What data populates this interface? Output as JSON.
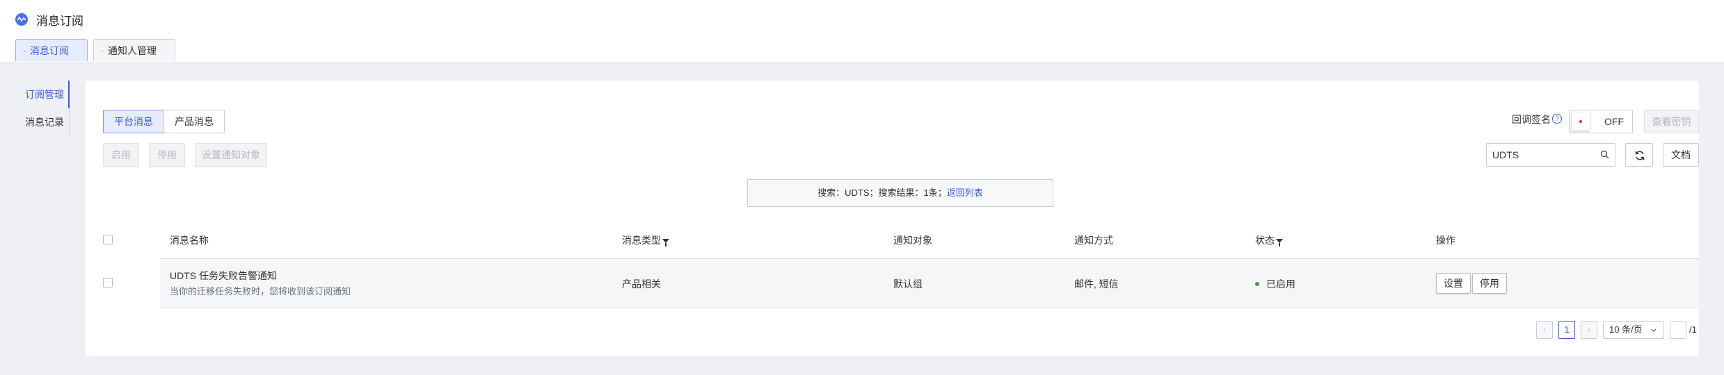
{
  "header": {
    "title": "消息订阅",
    "tabs": [
      {
        "label": "消息订阅",
        "active": true
      },
      {
        "label": "通知人管理",
        "active": false
      }
    ]
  },
  "sidebar": {
    "items": [
      {
        "label": "订阅管理",
        "active": true
      },
      {
        "label": "消息记录",
        "active": false
      }
    ]
  },
  "toolbar": {
    "segments": [
      {
        "label": "平台消息",
        "active": true
      },
      {
        "label": "产品消息",
        "active": false
      }
    ],
    "enable_label": "启用",
    "disable_label": "停用",
    "set_target_label": "设置通知对象",
    "callback_sign_label": "回调签名",
    "toggle_state": "OFF",
    "view_key_label": "查看密钥",
    "search_value": "UDTS",
    "docs_label": "文档"
  },
  "search_banner": {
    "text": "搜索：UDTS；搜索结果：1条；",
    "back_link": "返回列表"
  },
  "table": {
    "columns": [
      "消息名称",
      "消息类型",
      "通知对象",
      "通知方式",
      "状态",
      "操作"
    ],
    "rows": [
      {
        "name": "UDTS 任务失败告警通知",
        "description": "当你的迁移任务失败时，您将收到该订阅通知",
        "type": "产品相关",
        "target": "默认组",
        "method": "邮件, 短信",
        "status": "已启用",
        "actions": [
          "设置",
          "停用"
        ]
      }
    ]
  },
  "pagination": {
    "prev": "‹",
    "current_page": "1",
    "next": "›",
    "page_size": "10 条/页",
    "jump_value": "",
    "total_pages": "/1"
  },
  "colors": {
    "accent": "#3b5bdb",
    "status_enabled": "#2f9e44",
    "page_background": "#eef0f5"
  },
  "icons": [
    "logo-icon",
    "help-icon",
    "search-icon",
    "refresh-icon",
    "filter-icon",
    "chevron-down-icon"
  ]
}
